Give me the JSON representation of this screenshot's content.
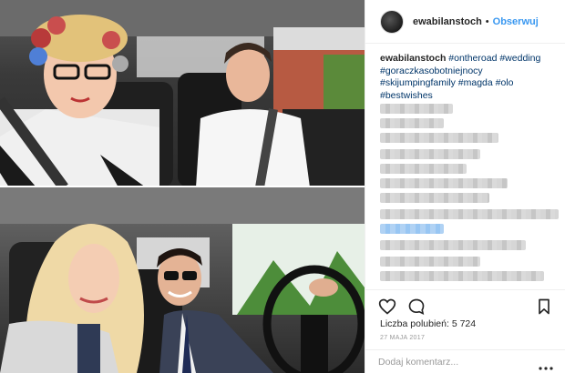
{
  "post": {
    "username": "ewabilanstoch",
    "separator": "•",
    "follow_label": "Obserwuj",
    "caption_user": "ewabilanstoch",
    "hashtags": [
      "#ontheroad",
      "#wedding",
      "#goraczkasobotniejnocy",
      "#skijumpingfamily",
      "#magda",
      "#olo",
      "#bestwishes"
    ],
    "likes_label": "Liczba polubień:",
    "likes_count": "5 724",
    "date": "27 MAJA 2017",
    "comment_placeholder": "Dodaj komentarz..."
  },
  "icons": {
    "like": "heart-icon",
    "comment": "comment-bubble-icon",
    "save": "bookmark-icon",
    "more": "more-dots-icon"
  },
  "colors": {
    "link_blue": "#3897f0",
    "hashtag_blue": "#003569",
    "muted_gray": "#999999",
    "border": "#efefef"
  }
}
